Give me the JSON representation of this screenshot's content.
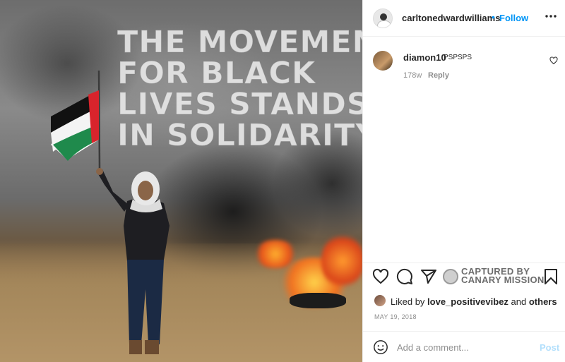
{
  "photo": {
    "headline_lines": [
      "THE MOVEMENT",
      "FOR BLACK",
      "LIVES STANDS",
      "IN SOLIDARITY"
    ]
  },
  "header": {
    "username": "carltonedwardwilliams",
    "separator": "•",
    "follow_label": "Follow",
    "more_icon": "more-horizontal-icon"
  },
  "comment": {
    "username": "diamon10",
    "text": "PSPSPS",
    "age": "178w",
    "reply_label": "Reply"
  },
  "actions": {
    "like_icon": "heart-icon",
    "comment_icon": "comment-icon",
    "share_icon": "paper-plane-icon",
    "save_icon": "bookmark-icon",
    "watermark_line1": "CAPTURED BY",
    "watermark_line2": "CANARY MISSION"
  },
  "likes": {
    "prefix": "Liked by ",
    "user": "love_positivevibez",
    "conjunction": " and ",
    "others": "others"
  },
  "date": "MAY 19, 2018",
  "comment_box": {
    "placeholder": "Add a comment...",
    "post_label": "Post"
  },
  "colors": {
    "link_blue": "#0095f6",
    "post_disabled": "#b2dffc",
    "muted_text": "#8e8e8e"
  }
}
